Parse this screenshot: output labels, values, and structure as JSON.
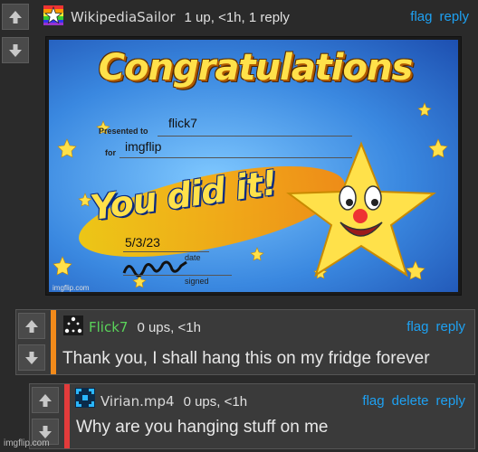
{
  "colors": {
    "link": "#1ea1f2",
    "stripe_reply1": "#f28a1a",
    "stripe_reply2": "#e33b3b",
    "username_flick": "#5ad35a"
  },
  "comments": [
    {
      "username": "WikipediaSailor",
      "meta": "1 up, <1h, 1 reply",
      "actions": [
        "flag",
        "reply"
      ],
      "avatar_icon": "rainbow-star-icon",
      "image": {
        "title": "Congratulations",
        "presented_label": "Presented to",
        "presented_value": "flick7",
        "for_label": "for",
        "for_value": "imgflip",
        "headline": "You did it!",
        "date_value": "5/3/23",
        "date_label": "date",
        "signed_label": "signed",
        "watermark": "imgflip.com"
      }
    },
    {
      "username": "Flick7",
      "meta": "0 ups, <1h",
      "actions": [
        "flag",
        "reply"
      ],
      "avatar_icon": "dots-triangle-icon",
      "text": "Thank you, I shall hang this on my fridge forever"
    },
    {
      "username": "Virian.mp4",
      "meta": "0 ups, <1h",
      "actions": [
        "flag",
        "delete",
        "reply"
      ],
      "avatar_icon": "pixel-square-icon",
      "text": "Why are you hanging stuff on me"
    }
  ],
  "page_watermark": "imgflip.com"
}
